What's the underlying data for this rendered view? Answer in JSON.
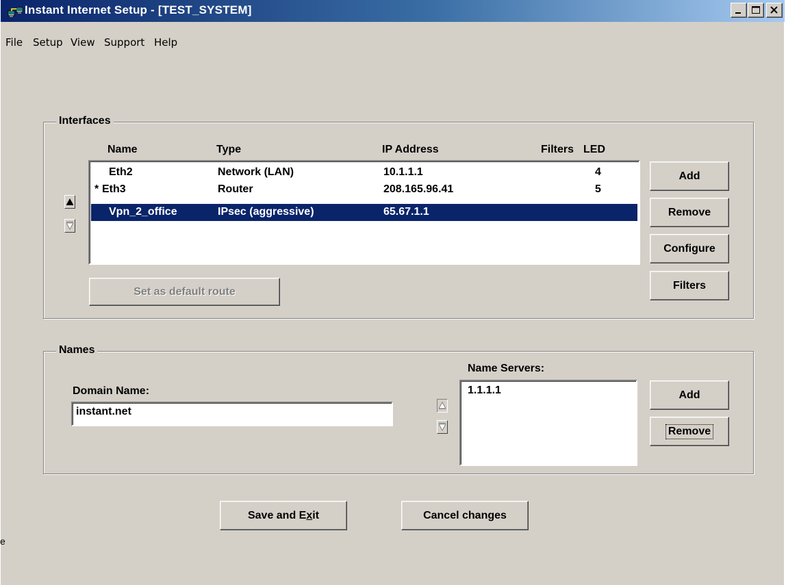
{
  "window": {
    "title": "Instant Internet Setup - [TEST_SYSTEM]",
    "controls": [
      "minimize-icon",
      "maximize-icon",
      "close-icon"
    ]
  },
  "menu": [
    "File",
    "Setup",
    "View",
    "Support",
    "Help"
  ],
  "interfaces": {
    "group_label": "Interfaces",
    "columns": {
      "name": "Name",
      "type": "Type",
      "ip": "IP Address",
      "filters": "Filters",
      "led": "LED"
    },
    "rows": [
      {
        "marker": "",
        "name": "Eth2",
        "type": "Network (LAN)",
        "ip": "10.1.1.1",
        "filters": "",
        "led": "4",
        "selected": false
      },
      {
        "marker": "*",
        "name": "Eth3",
        "type": "Router",
        "ip": "208.165.96.41",
        "filters": "",
        "led": "5",
        "selected": false
      },
      {
        "marker": "",
        "name": "Vpn_2_office",
        "type": "IPsec (aggressive)",
        "ip": "65.67.1.1",
        "filters": "",
        "led": "",
        "selected": true
      }
    ],
    "buttons": {
      "add": "Add",
      "remove": "Remove",
      "configure": "Configure",
      "filters": "Filters",
      "default_route": "Set as default route"
    }
  },
  "names": {
    "group_label": "Names",
    "domain_label": "Domain Name:",
    "domain_value": "instant.net",
    "servers_label": "Name Servers:",
    "servers": [
      "1.1.1.1"
    ],
    "buttons": {
      "add": "Add",
      "remove": "Remove"
    }
  },
  "footer": {
    "save_prefix": "Save and E",
    "save_mnemonic": "x",
    "save_suffix": "it",
    "cancel": "Cancel changes"
  },
  "stray_char": "e"
}
